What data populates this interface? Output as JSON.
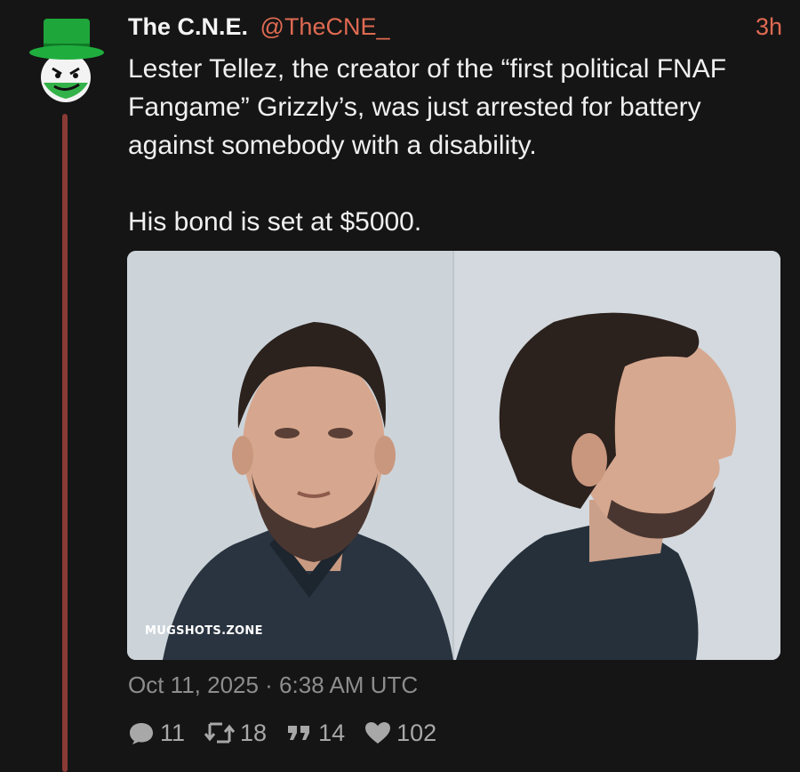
{
  "post": {
    "display_name": "The C.N.E.",
    "handle": "@TheCNE_",
    "time_ago": "3h",
    "text_p1": "Lester Tellez, the creator of the “first political FNAF Fangame” Grizzly’s, was just arrested for battery against somebody with a disability.",
    "text_p2": "His bond is set at $5000.",
    "media_watermark": "MUGSHOTS.ZONE",
    "timestamp": "Oct 11, 2025 · 6:38 AM UTC"
  },
  "stats": {
    "replies": "11",
    "reposts": "18",
    "quotes": "14",
    "likes": "102"
  },
  "colors": {
    "background": "#151515",
    "accent": "#e06a52",
    "thread_line": "#8a3a35",
    "muted": "#8d8d8d"
  },
  "icons": [
    "avatar-green-top-hat",
    "reply-icon",
    "repost-icon",
    "quote-icon",
    "heart-icon"
  ]
}
